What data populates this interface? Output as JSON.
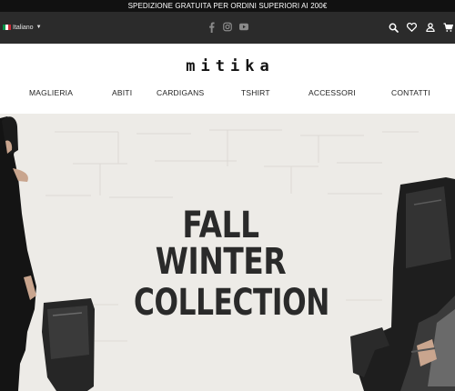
{
  "promo": {
    "text": "SPEDIZIONE GRATUITA PER ORDINI SUPERIORI AI 200€"
  },
  "language": {
    "label": "Italiano",
    "flag_colors": [
      "#009246",
      "#ffffff",
      "#ce2b37"
    ]
  },
  "social": {
    "icons": [
      "facebook-icon",
      "instagram-icon",
      "youtube-icon"
    ]
  },
  "utility": {
    "icons": [
      "search-icon",
      "heart-icon",
      "user-icon",
      "cart-icon"
    ]
  },
  "brand": {
    "logo": "mitika"
  },
  "nav": {
    "items": [
      {
        "label": "MAGLIERIA"
      },
      {
        "label": "ABITI"
      },
      {
        "label": "CARDIGANS"
      },
      {
        "label": "TSHIRT"
      },
      {
        "label": "ACCESSORI"
      },
      {
        "label": "CONTATTI"
      }
    ]
  },
  "hero": {
    "line1": "FALL WINTER",
    "line2": "COLLECTION"
  },
  "colors": {
    "topbar": "#2b2b2b",
    "promo": "#111111",
    "hero_bg": "#eeece8",
    "text": "#222222"
  }
}
